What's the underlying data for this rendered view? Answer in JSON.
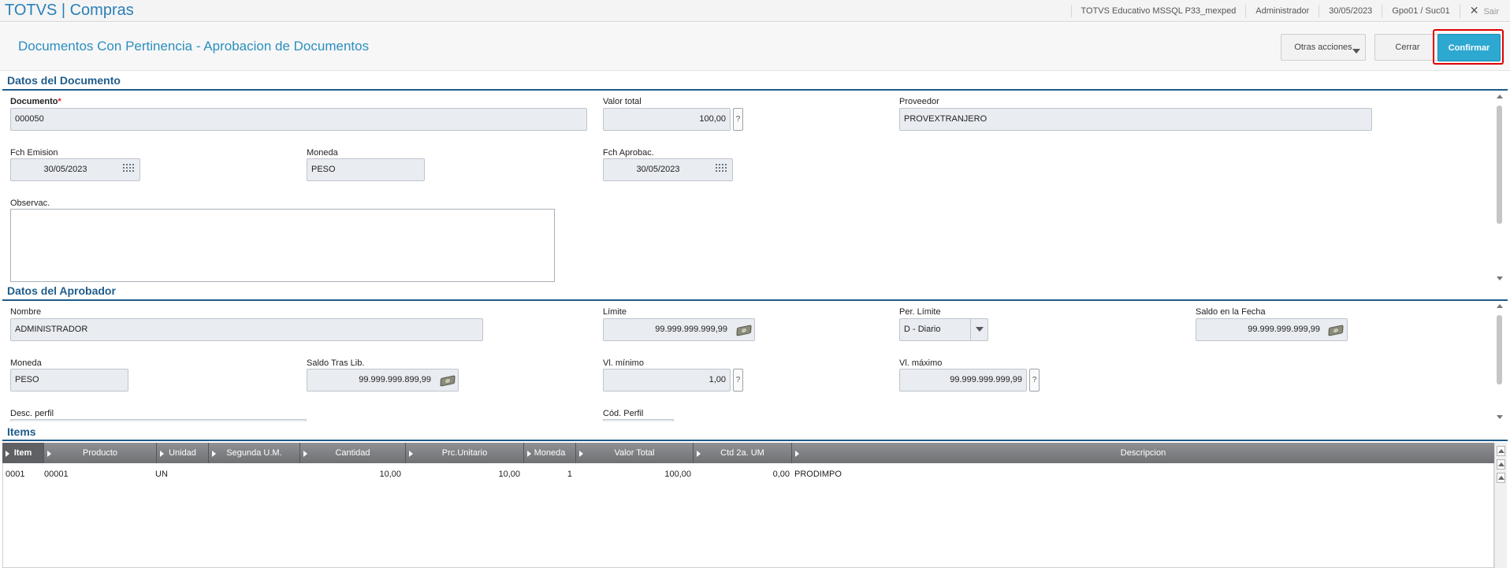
{
  "topbar": {
    "app_title": "TOTVS | Compras",
    "environment": "TOTVS Educativo MSSQL P33_mexped",
    "user": "Administrador",
    "date": "30/05/2023",
    "branch": "Gpo01 / Suc01",
    "exit_label": "Sair"
  },
  "header": {
    "title": "Documentos Con Pertinencia - Aprobacion de Documentos",
    "otras_label": "Otras acciones",
    "cerrar_label": "Cerrar",
    "confirmar_label": "Confirmar"
  },
  "documento": {
    "section_title": "Datos del Documento",
    "documento_label": "Documento",
    "required_mark": "*",
    "documento_value": "000050",
    "valor_total_label": "Valor total",
    "valor_total_value": "100,00",
    "proveedor_label": "Proveedor",
    "proveedor_value": "PROVEXTRANJERO",
    "fch_emision_label": "Fch Emision",
    "fch_emision_value": "30/05/2023",
    "moneda_label": "Moneda",
    "moneda_value": "PESO",
    "fch_aprobac_label": "Fch Aprobac.",
    "fch_aprobac_value": "30/05/2023",
    "observac_label": "Observac.",
    "observac_value": ""
  },
  "aprobador": {
    "section_title": "Datos del Aprobador",
    "nombre_label": "Nombre",
    "nombre_value": "ADMINISTRADOR",
    "limite_label": "Límite",
    "limite_value": "99.999.999.999,99",
    "per_limite_label": "Per. Límite",
    "per_limite_value": "D - Diario",
    "saldo_fecha_label": "Saldo en la Fecha",
    "saldo_fecha_value": "99.999.999.999,99",
    "moneda_label": "Moneda",
    "moneda_value": "PESO",
    "saldo_tras_label": "Saldo Tras Lib.",
    "saldo_tras_value": "99.999.999.899,99",
    "vl_minimo_label": "Vl. mínimo",
    "vl_minimo_value": "1,00",
    "vl_maximo_label": "Vl. máximo",
    "vl_maximo_value": "99.999.999.999,99",
    "desc_perfil_label": "Desc. perfil",
    "cod_perfil_label": "Cód. Perfil"
  },
  "items": {
    "section_title": "Items",
    "columns": [
      "Item",
      "Producto",
      "Unidad",
      "Segunda U.M.",
      "Cantidad",
      "Prc.Unitario",
      "Moneda",
      "Valor Total",
      "Ctd 2a. UM",
      "Descripcion"
    ],
    "rows": [
      [
        "0001",
        "00001",
        "UN",
        "",
        "10,00",
        "10,00",
        "1",
        "100,00",
        "0,00",
        "PRODIMPO"
      ]
    ]
  },
  "icons": {
    "help": "?",
    "close": "✕"
  },
  "colors": {
    "brand": "#2b7fb8",
    "confirm": "#2da8d0",
    "highlight": "#e00000",
    "section": "#1f5c8b"
  }
}
